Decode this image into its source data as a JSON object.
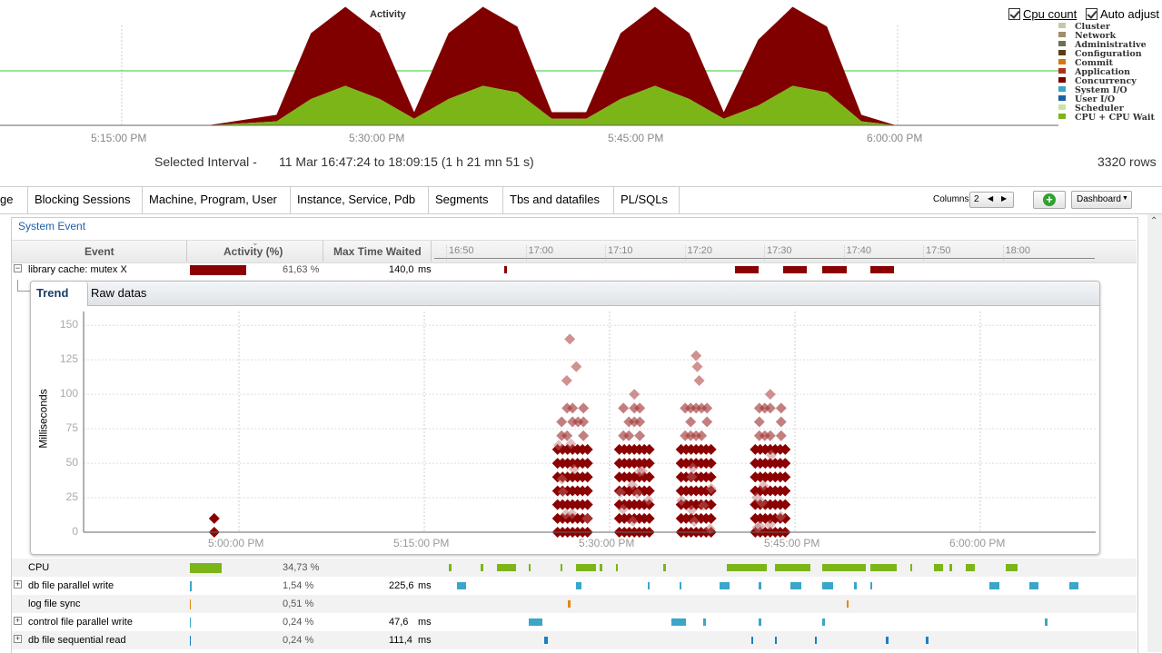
{
  "activity": {
    "title": "Activity",
    "x_ticks": [
      "5:15:00 PM",
      "5:30:00 PM",
      "5:45:00 PM",
      "6:00:00 PM"
    ],
    "cpu_count_label": "Cpu count",
    "auto_adjust_label": "Auto adjust",
    "legend": [
      {
        "name": "Cluster",
        "color": "#c8c8a8"
      },
      {
        "name": "Network",
        "color": "#9e8e6b"
      },
      {
        "name": "Administrative",
        "color": "#6f6f56"
      },
      {
        "name": "Configuration",
        "color": "#5a3e16"
      },
      {
        "name": "Commit",
        "color": "#d27a10"
      },
      {
        "name": "Application",
        "color": "#b03020"
      },
      {
        "name": "Concurrency",
        "color": "#7f0000"
      },
      {
        "name": "System I/O",
        "color": "#3aa6c8"
      },
      {
        "name": "User I/O",
        "color": "#1a5fa8"
      },
      {
        "name": "Scheduler",
        "color": "#c8e6a0"
      },
      {
        "name": "CPU + CPU Wait",
        "color": "#7cb518"
      }
    ],
    "selected_interval_label": "Selected Interval  -",
    "selected_interval_value": "11 Mar 16:47:24 to 18:09:15 (1 h 21 mn 51 s)",
    "rows_count": "3320 rows",
    "chart_data": {
      "type": "area",
      "x": [
        "17:02",
        "17:20",
        "17:24",
        "17:26",
        "17:28",
        "17:30",
        "17:32",
        "17:34",
        "17:36",
        "17:38",
        "17:40",
        "17:42",
        "17:44",
        "17:46",
        "17:48",
        "17:50",
        "17:52",
        "17:54",
        "17:56",
        "17:58",
        "18:00",
        "18:26"
      ],
      "series": [
        {
          "name": "CPU + CPU Wait",
          "values": [
            0,
            0,
            0.3,
            2,
            3,
            2,
            0.5,
            2,
            3,
            2.5,
            0.5,
            0.5,
            2,
            3,
            2,
            0.5,
            1.5,
            3,
            2.5,
            0.3,
            0,
            0
          ]
        },
        {
          "name": "Concurrency",
          "values": [
            0,
            0,
            0.5,
            5,
            6,
            5,
            0.5,
            5,
            6,
            5,
            0.5,
            0.5,
            5,
            6,
            5,
            0.5,
            5,
            6,
            5,
            0.5,
            0,
            0
          ]
        }
      ]
    }
  },
  "tabs": [
    "ge",
    "Blocking Sessions",
    "Machine, Program, User",
    "Instance, Service, Pdb",
    "Segments",
    "Tbs and datafiles",
    "PL/SQLs"
  ],
  "toolbar": {
    "columns_label": "Columns",
    "columns_value": "2",
    "dashboard_label": "Dashboard"
  },
  "system_event": {
    "title": "System Event",
    "headers": {
      "event": "Event",
      "activity": "Activity (%)",
      "max_time": "Max Time Waited"
    },
    "timeline_ticks": [
      "16:50",
      "17:00",
      "17:10",
      "17:20",
      "17:30",
      "17:40",
      "17:50",
      "18:00"
    ],
    "rows": [
      {
        "name": "library cache: mutex X",
        "activity_pct": "61,63 %",
        "activity": 61.63,
        "max_time": "140,0",
        "unit": "ms",
        "color": "#8b0000",
        "expanded": true
      },
      {
        "name": "CPU",
        "activity_pct": "34,73 %",
        "activity": 34.73,
        "max_time": "",
        "unit": "",
        "color": "#7cb518",
        "expanded": false
      },
      {
        "name": "db file parallel write",
        "activity_pct": "1,54 %",
        "activity": 1.54,
        "max_time": "225,6",
        "unit": "ms",
        "color": "#3aa6c8",
        "expanded": false
      },
      {
        "name": "log file sync",
        "activity_pct": "0,51 %",
        "activity": 0.51,
        "max_time": "",
        "unit": "",
        "color": "#e08a10",
        "expanded": false
      },
      {
        "name": "control file parallel write",
        "activity_pct": "0,24 %",
        "activity": 0.24,
        "max_time": "47,6",
        "unit": "ms",
        "color": "#3aa6c8",
        "expanded": false
      },
      {
        "name": "db file sequential read",
        "activity_pct": "0,24 %",
        "activity": 0.24,
        "max_time": "111,4",
        "unit": "ms",
        "color": "#1a7fc8",
        "expanded": false
      }
    ]
  },
  "trend": {
    "tabs": [
      "Trend",
      "Raw datas"
    ],
    "ylabel": "Milliseconds",
    "y_ticks": [
      "150",
      "125",
      "100",
      "75",
      "50",
      "25",
      "0"
    ],
    "x_ticks": [
      "5:00:00 PM",
      "5:15:00 PM",
      "5:30:00 PM",
      "5:45:00 PM",
      "6:00:00 PM"
    ],
    "chart_data": {
      "type": "scatter",
      "ylabel": "Milliseconds",
      "ylim": [
        0,
        160
      ],
      "clusters": [
        {
          "time": "16:58",
          "values": [
            0,
            10
          ]
        },
        {
          "time": "17:27",
          "max": 140
        },
        {
          "time": "17:32",
          "max": 100
        },
        {
          "time": "17:37",
          "max": 128
        },
        {
          "time": "17:43",
          "max": 100
        }
      ]
    }
  }
}
